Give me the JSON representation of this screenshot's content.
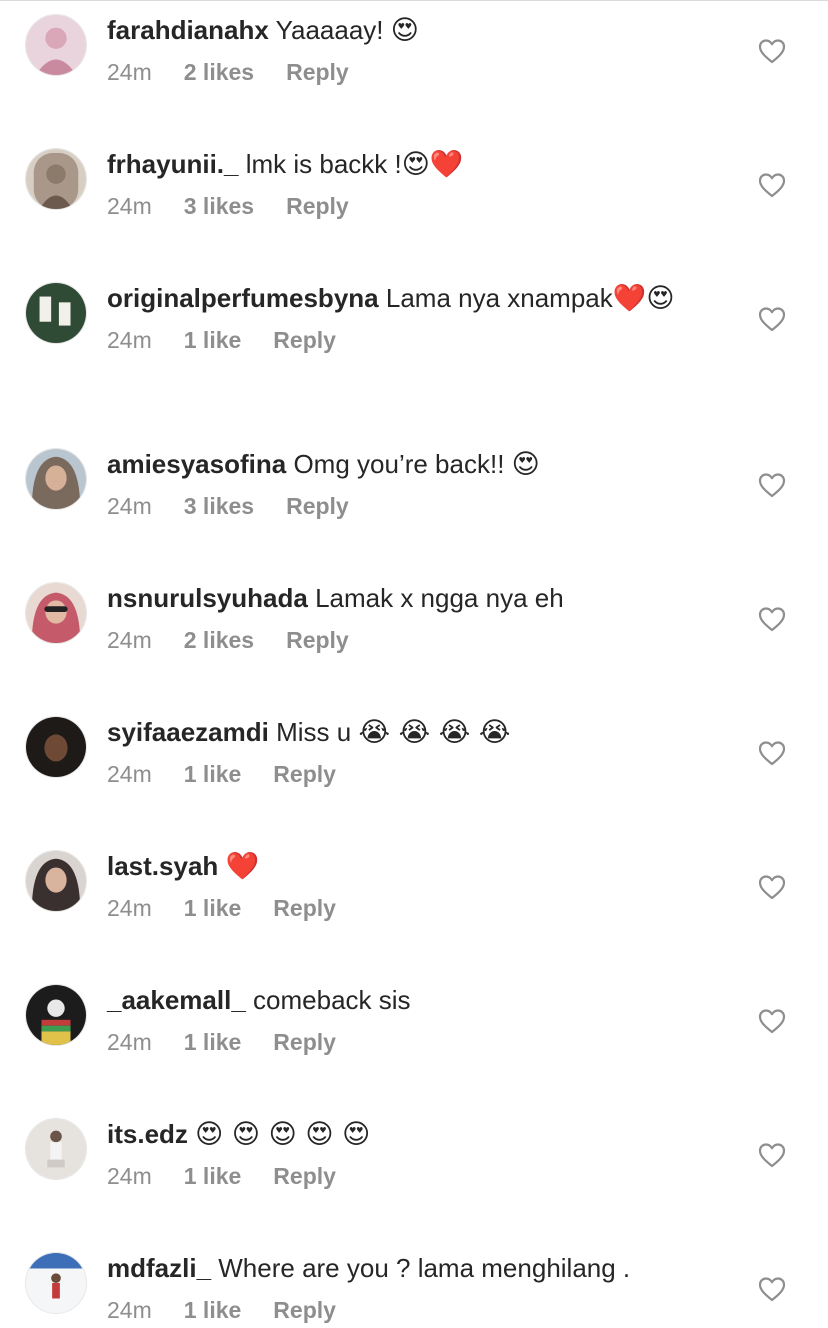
{
  "comments": [
    {
      "username": "farahdianahx",
      "text": "Yaaaaay!",
      "emoji": "😍",
      "time": "24m",
      "likes": "2 likes",
      "reply": "Reply",
      "avatar_color": "#d9a7b7"
    },
    {
      "username": "frhayunii._",
      "text": "lmk is backk !",
      "emoji": "😍❤️",
      "time": "24m",
      "likes": "3 likes",
      "reply": "Reply",
      "avatar_color": "#8c7a6b"
    },
    {
      "username": "originalperfumesbyna",
      "text": "Lama nya xnampak",
      "emoji": "❤️😍",
      "time": "24m",
      "likes": "1 like",
      "reply": "Reply",
      "avatar_color": "#2f4a35"
    },
    {
      "username": "amiesyasofina",
      "text": "Omg you’re back!!",
      "emoji": "😍",
      "time": "24m",
      "likes": "3 likes",
      "reply": "Reply",
      "avatar_color": "#7a6a5e"
    },
    {
      "username": "nsnurulsyuhada",
      "text": "Lamak x ngga nya eh",
      "emoji": "",
      "time": "24m",
      "likes": "2 likes",
      "reply": "Reply",
      "avatar_color": "#c45a6a"
    },
    {
      "username": "syifaaezamdi",
      "text": "Miss u",
      "emoji": "😭 😭 😭 😭",
      "time": "24m",
      "likes": "1 like",
      "reply": "Reply",
      "avatar_color": "#1e1a18"
    },
    {
      "username": "last.syah",
      "text": "",
      "emoji": "❤️",
      "time": "24m",
      "likes": "1 like",
      "reply": "Reply",
      "avatar_color": "#3a3030"
    },
    {
      "username": "_aakemall_",
      "text": "comeback sis",
      "emoji": "",
      "time": "24m",
      "likes": "1 like",
      "reply": "Reply",
      "avatar_color": "#1c1c1c"
    },
    {
      "username": "its.edz",
      "text": "",
      "emoji": "😍 😍 😍 😍 😍",
      "time": "24m",
      "likes": "1 like",
      "reply": "Reply",
      "avatar_color": "#cfcac4"
    },
    {
      "username": "mdfazli_",
      "text": "Where are you ? lama menghilang .",
      "emoji": "",
      "time": "24m",
      "likes": "1 like",
      "reply": "Reply",
      "avatar_color": "#3d6fb8"
    }
  ],
  "icons": {
    "like": "heart-outline-icon"
  }
}
